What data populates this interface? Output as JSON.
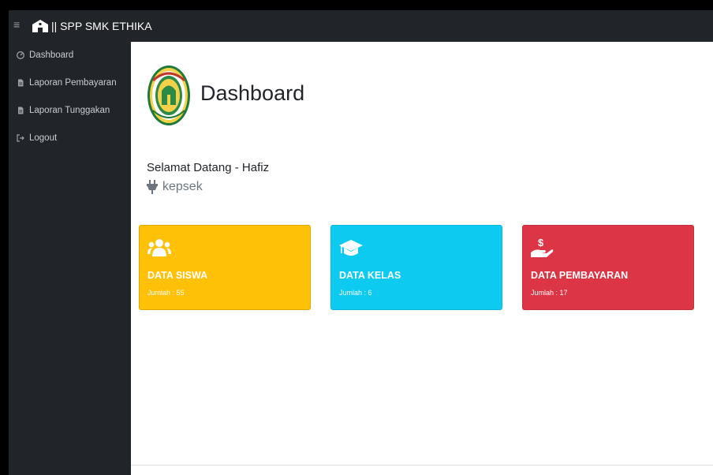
{
  "topbar": {
    "brand": "|| SPP SMK ETHIKA",
    "brand_icon": "school-icon",
    "menu_icon": "hamburger-icon"
  },
  "sidebar": {
    "items": [
      {
        "label": "Dashboard",
        "icon": "tachometer-icon"
      },
      {
        "label": "Laporan Pembayaran",
        "icon": "file-icon"
      },
      {
        "label": "Laporan Tunggakan",
        "icon": "file-icon"
      },
      {
        "label": "Logout",
        "icon": "sign-out-icon"
      }
    ]
  },
  "main": {
    "title": "Dashboard",
    "welcome": "Selamat Datang - Hafiz",
    "role": "kepsek",
    "role_icon": "plug-icon",
    "cards": [
      {
        "title": "DATA SISWA",
        "count": "Jumlah : 55",
        "icon": "users-icon",
        "color": "#ffc107"
      },
      {
        "title": "DATA KELAS",
        "count": "Jumlah : 6",
        "icon": "graduation-cap-icon",
        "color": "#0dcaf0"
      },
      {
        "title": "DATA PEMBAYARAN",
        "count": "Jumlah : 17",
        "icon": "hand-dollar-icon",
        "color": "#dc3545"
      }
    ]
  },
  "colors": {
    "sidebar_bg": "#212529",
    "main_bg": "#ffffff"
  }
}
